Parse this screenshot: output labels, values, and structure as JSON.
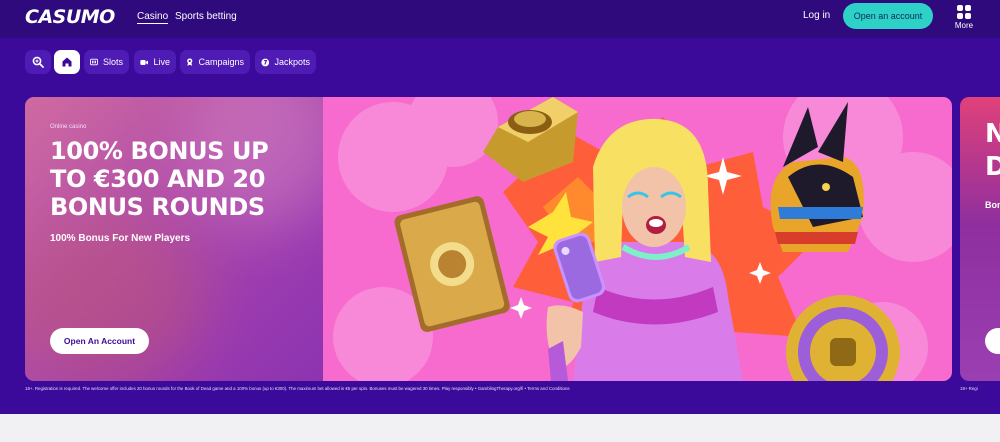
{
  "colors": {
    "header_bg": "#2f0a7d",
    "page_bg": "#3c0a9a",
    "accent_teal": "#2ed1c6",
    "hero_pink": "#f66bcd",
    "footer_bg": "#f1f1f4"
  },
  "header": {
    "logo": "CASUMO",
    "nav": [
      "Casino",
      "Sports betting"
    ],
    "login_label": "Log in",
    "open_account_label": "Open an account",
    "more_label": "More"
  },
  "pills": [
    {
      "icon": "search-icon",
      "label": ""
    },
    {
      "icon": "home-icon",
      "label": ""
    },
    {
      "icon": "slots-icon",
      "label": "Slots"
    },
    {
      "icon": "live-camera-icon",
      "label": "Live"
    },
    {
      "icon": "campaign-badge-icon",
      "label": "Campaigns"
    },
    {
      "icon": "jackpot-icon",
      "label": "Jackpots"
    }
  ],
  "hero": {
    "eyebrow": "Online casino",
    "headline": "100% BONUS UP TO €300 AND 20 BONUS ROUNDS",
    "subline": "100% Bonus For New Players",
    "button_label": "Open An Account",
    "disclaimer": "18+. Registration is required. The welcome offer includes 20 bonus rounds for the Book of Dead game and a 100% bonus (up to €300). The maximum bet allowed is €5 per spin. Bonuses must be wagered 30 times. Play responsibly • GamblingTherapy.org/fi • Terms and Conditions"
  },
  "hero_next": {
    "line1": "N",
    "line2": "D",
    "sub": "Bon",
    "disclaimer": "18+ Regi"
  }
}
